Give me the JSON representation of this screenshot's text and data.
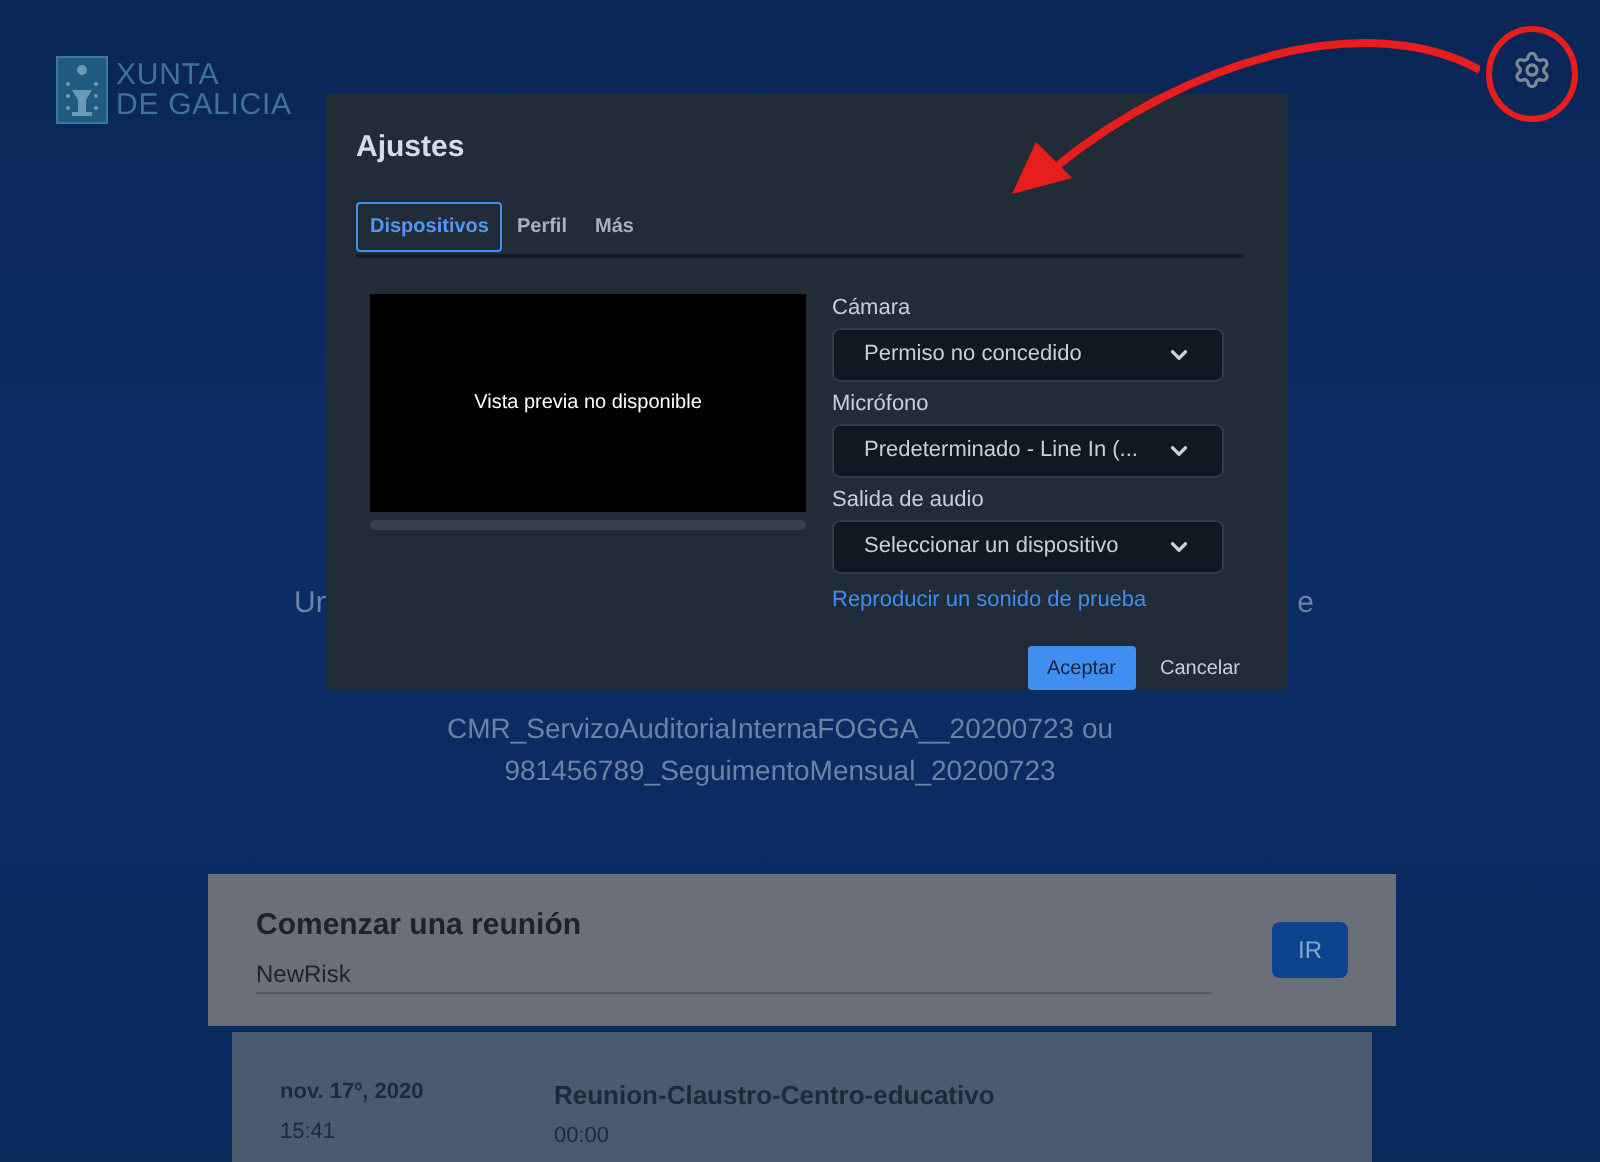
{
  "header": {
    "logo": {
      "line_1": "XUNTA",
      "line_2": "DE GALICIA"
    }
  },
  "intro": {
    "line_1_start": "Un",
    "line_1_end": "e",
    "line_2": "CMR_ServizoAuditoriaInternaFOGGA__20200723 ou",
    "line_3": "981456789_SeguimentoMensual_20200723"
  },
  "start_meeting": {
    "title": "Comenzar una reunión",
    "input_value": "NewRisk",
    "button": "IR"
  },
  "recent_meetings": [
    {
      "date": "nov. 17º, 2020",
      "time": "15:41",
      "name": "Reunion-Claustro-Centro-educativo",
      "duration": "00:00"
    }
  ],
  "settings_dialog": {
    "title": "Ajustes",
    "tabs": [
      {
        "label": "Dispositivos",
        "selected": true
      },
      {
        "label": "Perfil",
        "selected": false
      },
      {
        "label": "Más",
        "selected": false
      }
    ],
    "preview_text": "Vista previa no disponible",
    "fields": [
      {
        "label": "Cámara",
        "value": "Permiso no concedido"
      },
      {
        "label": "Micrófono",
        "value": "Predeterminado - Line In (..."
      },
      {
        "label": "Salida de audio",
        "value": "Seleccionar un dispositivo"
      }
    ],
    "test_sound_link": "Reproducir un sonido de prueba",
    "buttons": {
      "accept": "Aceptar",
      "cancel": "Cancelar"
    }
  }
}
